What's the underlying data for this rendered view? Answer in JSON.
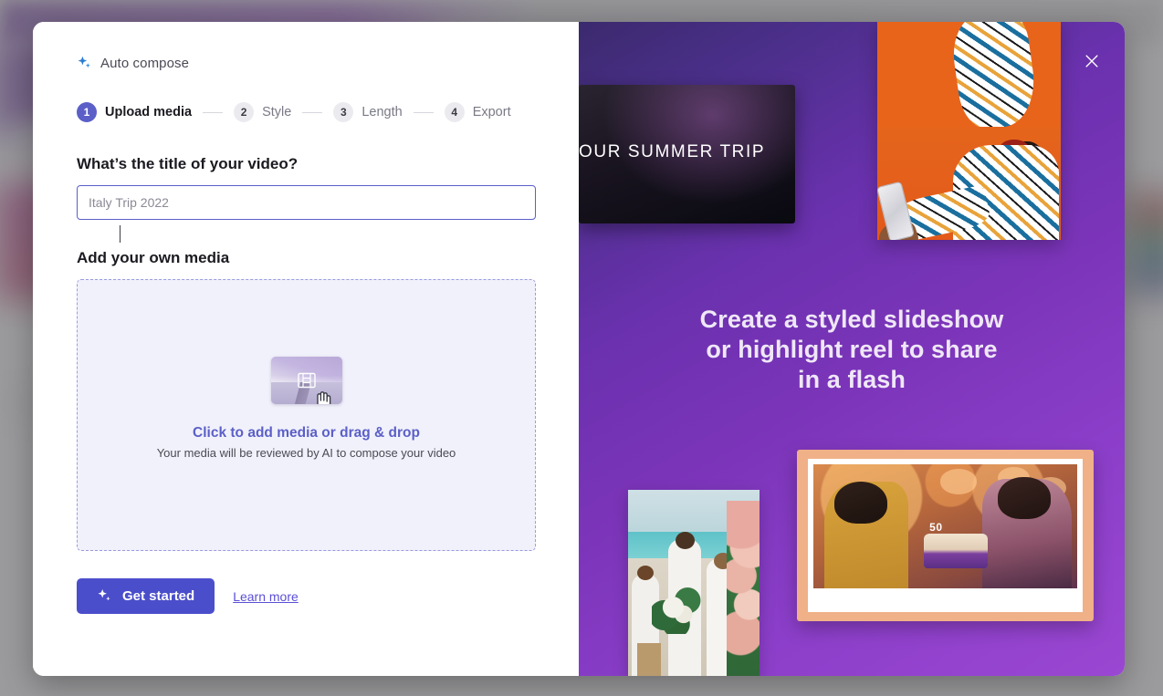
{
  "modal": {
    "brand": {
      "label": "Auto compose",
      "icon": "sparkles-icon"
    },
    "stepper": {
      "steps": [
        {
          "number": "1",
          "label": "Upload media",
          "state": "active"
        },
        {
          "number": "2",
          "label": "Style",
          "state": "idle"
        },
        {
          "number": "3",
          "label": "Length",
          "state": "idle"
        },
        {
          "number": "4",
          "label": "Export",
          "state": "idle"
        }
      ]
    },
    "title_field": {
      "label": "What’s the title of your video?",
      "value": "",
      "placeholder": "Italy Trip 2022",
      "focused": true
    },
    "media_section": {
      "label": "Add your own media",
      "dropzone": {
        "cta": "Click to add media or drag & drop",
        "subtext": "Your media will be reviewed by AI to compose your video",
        "thumb_icon": "film-strip-icon",
        "cursor": "hand-cursor"
      }
    },
    "footer": {
      "primary_button": "Get started",
      "primary_button_icon": "sparkles-icon",
      "link": "Learn more"
    },
    "close_button": {
      "icon": "close-icon",
      "label": "Close"
    }
  },
  "promo": {
    "headline_lines": [
      "Create a styled slideshow",
      "or highlight reel to share",
      "in a flash"
    ],
    "headline": "Create a styled slideshow or highlight reel to share in a flash",
    "cards": {
      "dark_video": {
        "overlay_text": "OUR SUMMER TRIP"
      },
      "selfie": {
        "alt": "Woman taking a selfie on an orange background"
      },
      "wedding": {
        "alt": "Beach wedding party with bouquet"
      },
      "party": {
        "alt": "Birthday party with a 50 cake",
        "cake_number": "50"
      }
    }
  },
  "colors": {
    "accent_purple": "#5b5fc7",
    "button_purple": "#4b4ecb",
    "link_purple": "#5b4fd6",
    "dropzone_bg": "#f1f1fb",
    "dropzone_border": "#9a9ae0",
    "promo_gradient_start": "#3b2a6e",
    "promo_gradient_end": "#9a47d2",
    "sparkle_blue": "#2b7cd3",
    "polaroid_frame": "#f0b088"
  }
}
